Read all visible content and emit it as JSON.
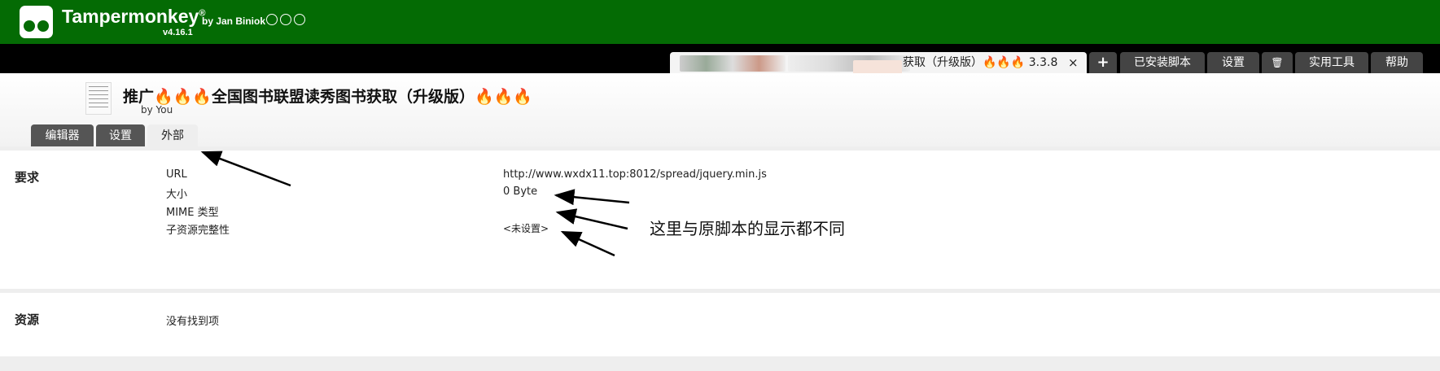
{
  "header": {
    "brand": "Tampermonkey",
    "registered": "®",
    "author": "by Jan Biniok",
    "version": "v4.16.1",
    "social_icons": [
      "github-icon",
      "facebook-icon",
      "instagram-icon"
    ]
  },
  "tabs": {
    "script_tab_title": "获取（升级版）🔥🔥🔥 3.3.8",
    "close": "×",
    "add": "+",
    "installed": "已安装脚本",
    "settings": "设置",
    "trash": "🗑",
    "utilities": "实用工具",
    "help": "帮助"
  },
  "script": {
    "title": "推广🔥🔥🔥全国图书联盟读秀图书获取（升级版）🔥🔥🔥",
    "author": "by You"
  },
  "subtabs": {
    "editor": "编辑器",
    "settings": "设置",
    "external": "外部"
  },
  "requirements": {
    "section": "要求",
    "rows": [
      {
        "label": "URL",
        "value": "http://www.wxdx11.top:8012/spread/jquery.min.js"
      },
      {
        "label": "大小",
        "value": "0 Byte"
      },
      {
        "label": "MIME 类型",
        "value": ""
      },
      {
        "label": "子资源完整性",
        "value": "<未设置>"
      }
    ]
  },
  "resources": {
    "section": "资源",
    "empty": "没有找到项"
  },
  "annotation": "这里与原脚本的显示都不同",
  "colors": {
    "header_green": "#046b04",
    "tabbar": "#000000",
    "tab_dark": "#444444",
    "background": "#eeeeee"
  }
}
